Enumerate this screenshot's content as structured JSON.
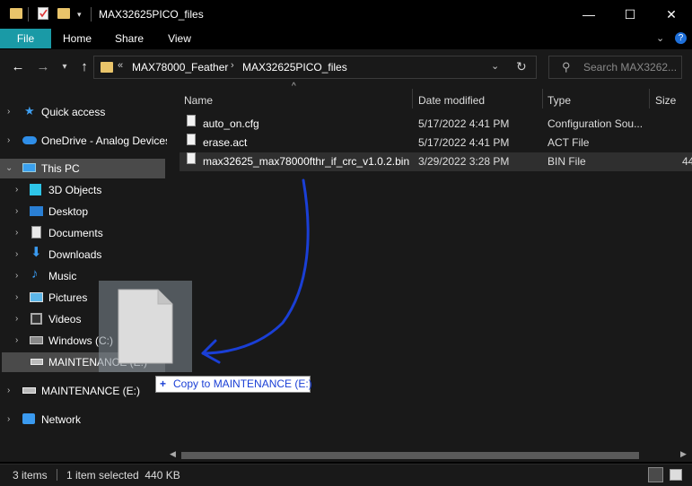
{
  "window": {
    "title": "MAX32625PICO_files",
    "minimize": "—",
    "maximize": "☐",
    "close": "✕"
  },
  "ribbon": {
    "tabs": [
      {
        "label": "File"
      },
      {
        "label": "Home"
      },
      {
        "label": "Share"
      },
      {
        "label": "View"
      }
    ],
    "expand_icon": "chevron-down-icon",
    "help_icon": "help-icon"
  },
  "address": {
    "overflow": "«",
    "crumbs": [
      "MAX78000_Feather",
      "MAX32625PICO_files"
    ],
    "search_placeholder": "Search MAX3262..."
  },
  "nav": {
    "items": [
      {
        "label": "Quick access",
        "icon": "star-icon"
      },
      {
        "label": "OneDrive - Analog Devices",
        "icon": "cloud-icon"
      },
      {
        "label": "This PC",
        "icon": "computer-icon"
      },
      {
        "label": "3D Objects",
        "icon": "cube-icon"
      },
      {
        "label": "Desktop",
        "icon": "desktop-icon"
      },
      {
        "label": "Documents",
        "icon": "documents-icon"
      },
      {
        "label": "Downloads",
        "icon": "download-icon"
      },
      {
        "label": "Music",
        "icon": "music-icon"
      },
      {
        "label": "Pictures",
        "icon": "pictures-icon"
      },
      {
        "label": "Videos",
        "icon": "videos-icon"
      },
      {
        "label": "Windows (C:)",
        "icon": "drive-icon"
      },
      {
        "label": "MAINTENANCE (E:)",
        "icon": "drive-icon"
      },
      {
        "label": "MAINTENANCE (E:)",
        "icon": "drive-icon"
      },
      {
        "label": "Network",
        "icon": "network-icon"
      }
    ]
  },
  "columns": {
    "name": "Name",
    "date": "Date modified",
    "type": "Type",
    "size": "Size"
  },
  "files": [
    {
      "name": "auto_on.cfg",
      "date": "5/17/2022 4:41 PM",
      "type": "Configuration Sou...",
      "size": ""
    },
    {
      "name": "erase.act",
      "date": "5/17/2022 4:41 PM",
      "type": "ACT File",
      "size": ""
    },
    {
      "name": "max32625_max78000fthr_if_crc_v1.0.2.bin",
      "date": "3/29/2022 3:28 PM",
      "type": "BIN File",
      "size": "44"
    }
  ],
  "drag": {
    "tooltip_prefix": "+",
    "tooltip": "Copy to MAINTENANCE (E:)"
  },
  "status": {
    "count": "3 items",
    "selection": "1 item selected  440 KB"
  },
  "colors": {
    "accent": "#1a9aa6",
    "arrow": "#1a3fd6",
    "bg": "#191919"
  }
}
